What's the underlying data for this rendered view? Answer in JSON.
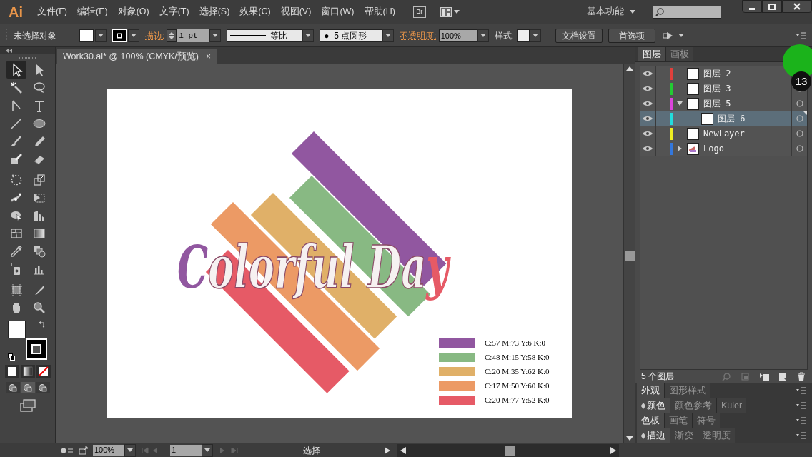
{
  "app": {
    "logo": "Ai"
  },
  "menu": [
    "文件(F)",
    "编辑(E)",
    "对象(O)",
    "文字(T)",
    "选择(S)",
    "效果(C)",
    "视图(V)",
    "窗口(W)",
    "帮助(H)"
  ],
  "app_bar": {
    "bridge": "Br",
    "workspace": "基本功能"
  },
  "control_bar": {
    "selection": "未选择对象",
    "stroke_label": "描边:",
    "stroke_weight": "1 pt",
    "profile": "等比",
    "brush": "●  5 点圆形",
    "opacity_label": "不透明度:",
    "opacity": "100%",
    "style_label": "样式:",
    "buttons": [
      "文档设置",
      "首选项"
    ]
  },
  "tools": [
    {
      "selected": true
    },
    {
      "selected": false
    },
    {
      "selected": false
    },
    {
      "selected": false
    },
    {
      "selected": false
    },
    {
      "selected": false
    },
    {
      "selected": false
    },
    {
      "selected": false
    },
    {
      "selected": false
    },
    {
      "selected": false
    },
    {
      "selected": false
    },
    {
      "selected": false
    },
    {
      "selected": false
    },
    {
      "selected": false
    },
    {
      "selected": false
    },
    {
      "selected": false
    },
    {
      "selected": false
    },
    {
      "selected": false
    },
    {
      "selected": false
    },
    {
      "selected": false
    },
    {
      "selected": false
    },
    {
      "selected": false
    },
    {
      "selected": false
    },
    {
      "selected": false
    },
    {
      "selected": false
    },
    {
      "selected": false
    },
    {
      "selected": false
    },
    {
      "selected": false
    }
  ],
  "document": {
    "tab": "Work30.ai* @ 100% (CMYK/预览)",
    "close": "×"
  },
  "artwork": {
    "title": "Colorful Day",
    "legend": [
      {
        "color": "#9157a0",
        "label": "C:57 M:73 Y:6 K:0"
      },
      {
        "color": "#88b983",
        "label": "C:48 M:15 Y:58 K:0"
      },
      {
        "color": "#e0b068",
        "label": "C:20 M:35 Y:62 K:0"
      },
      {
        "color": "#ec9a65",
        "label": "C:17 M:50 Y:60 K:0"
      },
      {
        "color": "#e65a66",
        "label": "C:20 M:77 Y:52 K:0"
      }
    ]
  },
  "layers_panel": {
    "tabs": [
      {
        "label": "图层",
        "selected": true
      },
      {
        "label": "画板",
        "selected": false
      }
    ],
    "layers": [
      {
        "name": "图层 2",
        "color": "#e0403c",
        "selected": false
      },
      {
        "name": "图层 3",
        "color": "#22cc33",
        "selected": false
      },
      {
        "name": "图层 5",
        "color": "#dd44dd",
        "selected": false,
        "expanded": true,
        "children": [
          {
            "name": "图层 6",
            "color": "#22dddd",
            "selected": true
          }
        ]
      },
      {
        "name": "NewLayer",
        "color": "#eeee22",
        "selected": false
      },
      {
        "name": "Logo",
        "color": "#3377dd",
        "selected": false,
        "expanded": false
      }
    ],
    "count": "5 个图层"
  },
  "panel_groups": [
    {
      "tabs": [
        {
          "label": "外观",
          "selected": true
        },
        {
          "label": "图形样式",
          "selected": false
        }
      ]
    },
    {
      "tabs": [
        {
          "label": "颜色",
          "selected": true
        },
        {
          "label": "颜色参考",
          "selected": false
        },
        {
          "label": "Kuler",
          "selected": false
        }
      ]
    },
    {
      "tabs": [
        {
          "label": "色板",
          "selected": true
        },
        {
          "label": "画笔",
          "selected": false
        },
        {
          "label": "符号",
          "selected": false
        }
      ]
    },
    {
      "tabs": [
        {
          "label": "描边",
          "selected": true
        },
        {
          "label": "渐变",
          "selected": false
        },
        {
          "label": "透明度",
          "selected": false
        }
      ]
    }
  ],
  "tutorial_marker": {
    "step": "13"
  },
  "status_bar": {
    "zoom": "100%",
    "artboard": "1",
    "tool": "选择"
  }
}
